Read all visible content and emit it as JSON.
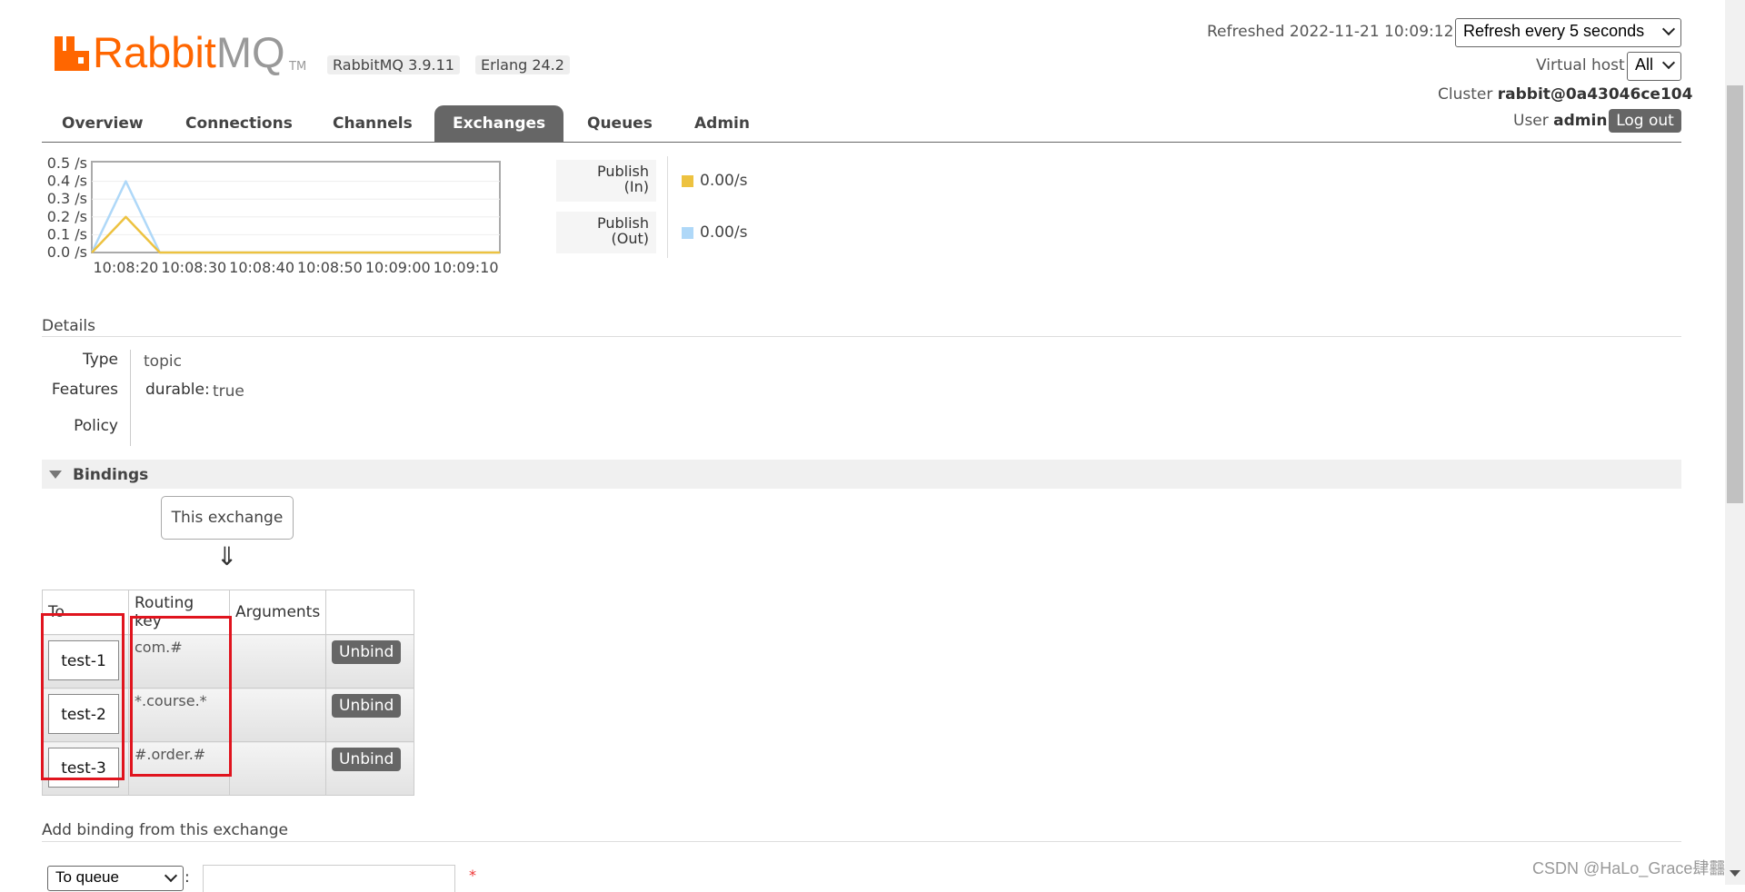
{
  "header": {
    "logo_rabbit": "Rabbit",
    "logo_mq": "MQ",
    "logo_tm": "TM",
    "version_rabbit": "RabbitMQ 3.9.11",
    "version_erlang": "Erlang 24.2",
    "brand_color": "#ff6600"
  },
  "top_right": {
    "refreshed_label": "Refreshed 2022-11-21 10:09:12",
    "refresh_select": "Refresh every 5 seconds",
    "vhost_label": "Virtual host",
    "vhost_select": "All",
    "cluster_label": "Cluster",
    "cluster_value": "rabbit@0a43046ce104",
    "user_label": "User",
    "user_value": "admin",
    "logout_label": "Log out"
  },
  "tabs": [
    {
      "label": "Overview",
      "active": false
    },
    {
      "label": "Connections",
      "active": false
    },
    {
      "label": "Channels",
      "active": false
    },
    {
      "label": "Exchanges",
      "active": true
    },
    {
      "label": "Queues",
      "active": false
    },
    {
      "label": "Admin",
      "active": false
    }
  ],
  "chart_data": {
    "type": "line",
    "y_ticks": [
      "0.5 /s",
      "0.4 /s",
      "0.3 /s",
      "0.2 /s",
      "0.1 /s",
      "0.0 /s"
    ],
    "x_ticks": [
      "10:08:20",
      "10:08:30",
      "10:08:40",
      "10:08:50",
      "10:09:00",
      "10:09:10"
    ],
    "ylim": [
      0,
      0.5
    ],
    "x": [
      "10:08:15",
      "10:08:20",
      "10:08:25",
      "10:08:30",
      "10:08:35",
      "10:08:40",
      "10:08:45",
      "10:08:50",
      "10:08:55",
      "10:09:00",
      "10:09:05",
      "10:09:10",
      "10:09:15"
    ],
    "series": [
      {
        "name": "Publish (In)",
        "color": "#edc240",
        "values": [
          0,
          0.2,
          0,
          0,
          0,
          0,
          0,
          0,
          0,
          0,
          0,
          0,
          0
        ]
      },
      {
        "name": "Publish (Out)",
        "color": "#afd8f8",
        "values": [
          0,
          0.4,
          0,
          0,
          0,
          0,
          0,
          0,
          0,
          0,
          0,
          0,
          0
        ]
      }
    ],
    "grid": true
  },
  "rates": {
    "in_label_1": "Publish",
    "in_label_2": "(In)",
    "in_value": "0.00/s",
    "out_label_1": "Publish",
    "out_label_2": "(Out)",
    "out_value": "0.00/s"
  },
  "details": {
    "title": "Details",
    "type_label": "Type",
    "type_value": "topic",
    "features_label": "Features",
    "durable_key": "durable:",
    "durable_value": "true",
    "policy_label": "Policy"
  },
  "bindings": {
    "title": "Bindings",
    "this_exchange": "This exchange",
    "arrow": "⇓",
    "columns": [
      "To",
      "Routing key",
      "Arguments",
      ""
    ],
    "rows": [
      {
        "to": "test-1",
        "routing_key": "com.#",
        "action": "Unbind"
      },
      {
        "to": "test-2",
        "routing_key": "*.course.*",
        "action": "Unbind"
      },
      {
        "to": "test-3",
        "routing_key": "#.order.#",
        "action": "Unbind"
      }
    ]
  },
  "add_binding": {
    "title": "Add binding from this exchange",
    "dest_type": "To queue",
    "colon": ":",
    "required_mark": "*"
  },
  "watermark": "CSDN @HaLo_Grace肆䨻"
}
